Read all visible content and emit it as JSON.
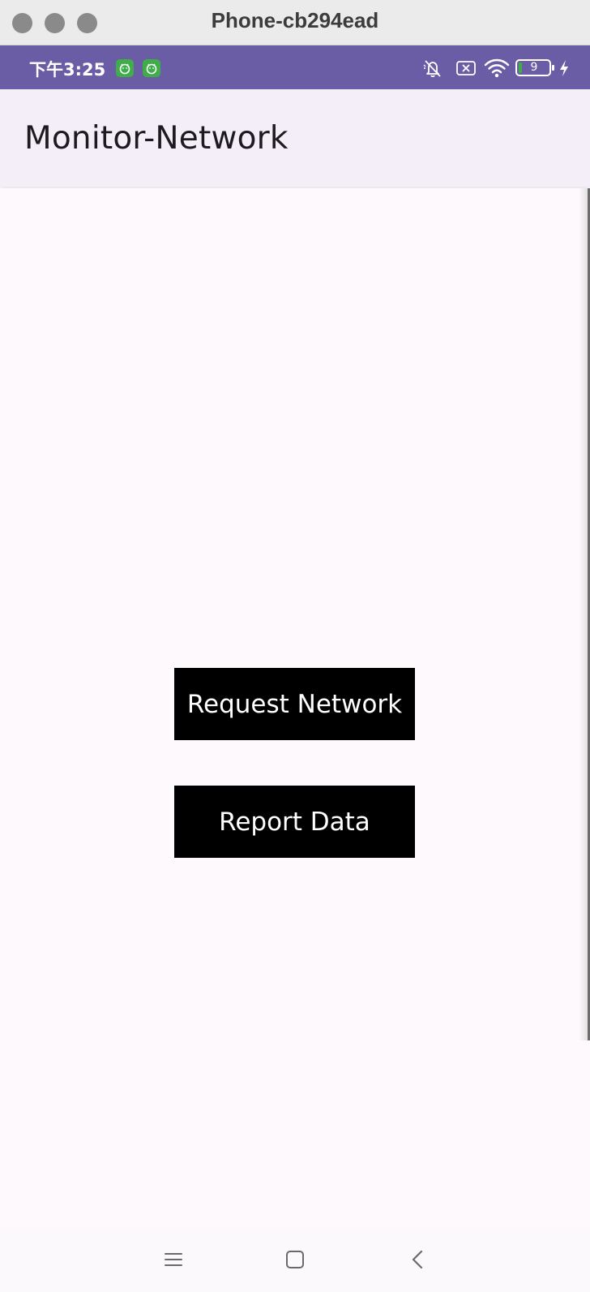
{
  "window": {
    "title": "Phone-cb294ead"
  },
  "status_bar": {
    "time": "下午3:25",
    "battery_level": "9",
    "icons": [
      "app-badge-icon",
      "app-badge-icon",
      "mute-icon",
      "no-sim-icon",
      "wifi-icon",
      "battery-icon",
      "charging-bolt-icon"
    ],
    "background_color": "#6b5ca6"
  },
  "app_bar": {
    "title": "Monitor-Network",
    "background_color": "#f4eef9"
  },
  "main": {
    "buttons": [
      {
        "label": "Request Network"
      },
      {
        "label": "Report Data"
      }
    ],
    "button_color": "#000000",
    "background_color": "#fdf9fc"
  },
  "nav_bar": {
    "icons": [
      "menu-icon",
      "home-icon",
      "back-icon"
    ]
  }
}
